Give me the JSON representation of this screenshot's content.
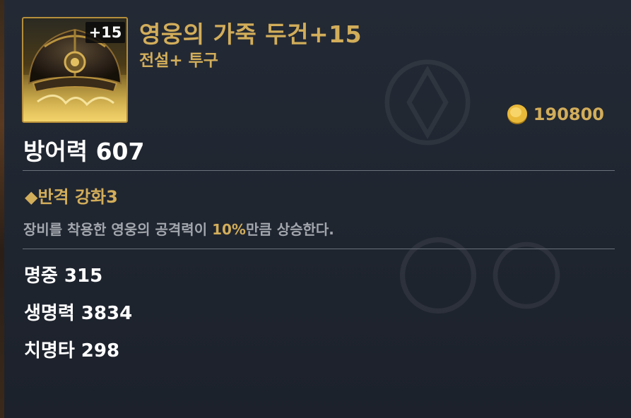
{
  "item": {
    "name": "영웅의 가죽 두건+15",
    "grade_type": "전설+ 투구",
    "enhance_badge": "+15",
    "icon": "leather-hood-icon"
  },
  "price": {
    "icon": "gold-coin-icon",
    "value": "190800"
  },
  "main_stat": "방어력 607",
  "skill": {
    "name": "◆반격 강화3",
    "desc_before": "장비를 착용한 영웅의 공격력이 ",
    "desc_highlight": "10%",
    "desc_after": "만큼 상승한다."
  },
  "stats": [
    "명중 315",
    "생명력 3834",
    "치명타 298"
  ],
  "colors": {
    "accent_gold": "#d2ad5a",
    "text_white": "#ffffff",
    "text_gray": "#a2a6ad",
    "background": "#1f2530"
  }
}
